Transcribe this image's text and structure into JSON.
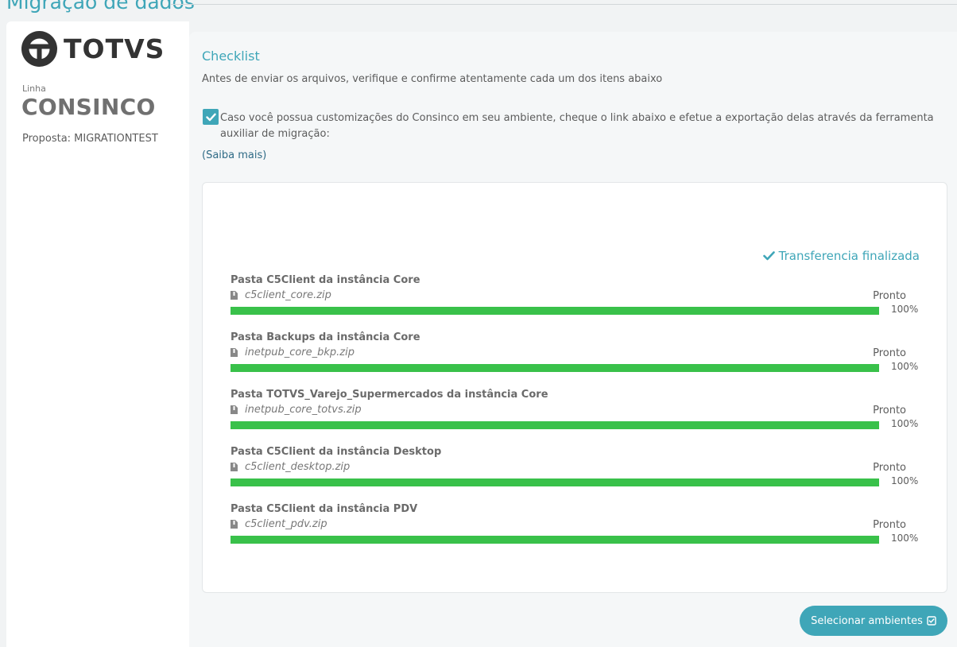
{
  "page": {
    "title": "Migração de dados"
  },
  "sidebar": {
    "brand": "TOTVS",
    "line_label": "Linha",
    "line_name": "CONSINCO",
    "proposal": "Proposta: MIGRATIONTEST"
  },
  "checklist": {
    "title": "Checklist",
    "description": "Antes de enviar os arquivos, verifique e confirme atentamente cada um dos itens abaixo",
    "customization_checked": true,
    "customization_text": "Caso você possua customizações do Consinco em seu ambiente, cheque o link abaixo e efetue a exportação delas através da ferramenta auxiliar de migração:",
    "learn_more": "(Saiba mais)"
  },
  "transfer": {
    "status_text": "Transferencia finalizada",
    "items": [
      {
        "title": "Pasta C5Client da instância Core",
        "file": "c5client_core.zip",
        "status": "Pronto",
        "percent": "100%",
        "progress": 1.0
      },
      {
        "title": "Pasta Backups da instância Core",
        "file": "inetpub_core_bkp.zip",
        "status": "Pronto",
        "percent": "100%",
        "progress": 1.0
      },
      {
        "title": "Pasta TOTVS_Varejo_Supermercados da instância Core",
        "file": "inetpub_core_totvs.zip",
        "status": "Pronto",
        "percent": "100%",
        "progress": 1.0
      },
      {
        "title": "Pasta C5Client da instância Desktop",
        "file": "c5client_desktop.zip",
        "status": "Pronto",
        "percent": "100%",
        "progress": 1.0
      },
      {
        "title": "Pasta C5Client da instância PDV",
        "file": "c5client_pdv.zip",
        "status": "Pronto",
        "percent": "100%",
        "progress": 1.0
      }
    ]
  },
  "actions": {
    "select_environments": "Selecionar ambientes"
  },
  "colors": {
    "accent": "#3fa6b8",
    "progress": "#39c14a",
    "link": "#2f6b86"
  }
}
